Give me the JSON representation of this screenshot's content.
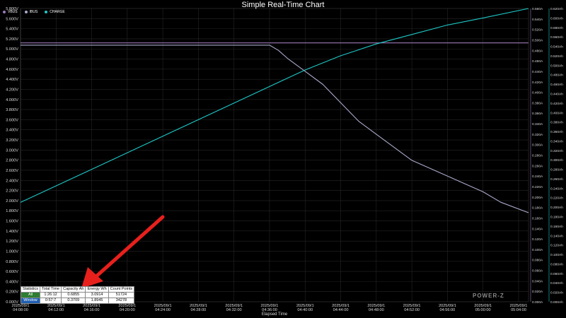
{
  "title": "Simple Real-Time Chart",
  "xlabel": "Elapsed Time",
  "watermark": "power-z",
  "colors": {
    "vbus": "#9c7ab8",
    "ibus": "#aaaacc",
    "charge": "#1ec8c8",
    "arrow": "#e8201c"
  },
  "legend": [
    {
      "name": "VBUS",
      "color": "#9c7ab8"
    },
    {
      "name": "IBUS",
      "color": "#aaaacc"
    },
    {
      "name": "CHARGE",
      "color": "#1ec8c8"
    }
  ],
  "stats": {
    "headers": [
      "Statistics",
      "Total Time",
      "Capacity Ah",
      "Energy Wh",
      "Count Points"
    ],
    "rows": [
      [
        "All",
        "1:26:12",
        "0.6855",
        "3.0914",
        "51724"
      ],
      [
        "Window",
        "0:57:7",
        "0.3709",
        "1.8945",
        "34278"
      ]
    ]
  },
  "chart_data": {
    "type": "line",
    "title": "Simple Real-Time Chart",
    "xlabel": "Elapsed Time",
    "grid": true,
    "legend_position": "top-left",
    "x_ticks": [
      [
        "2025/09/1",
        "04:08:00"
      ],
      [
        "2025/09/1",
        "04:12:00"
      ],
      [
        "2025/09/1",
        "04:16:00"
      ],
      [
        "2025/09/1",
        "04:20:00"
      ],
      [
        "2025/09/1",
        "04:24:00"
      ],
      [
        "2025/09/1",
        "04:28:00"
      ],
      [
        "2025/09/1",
        "04:32:00"
      ],
      [
        "2025/09/1",
        "04:36:00"
      ],
      [
        "2025/09/1",
        "04:40:00"
      ],
      [
        "2025/09/1",
        "04:44:00"
      ],
      [
        "2025/09/1",
        "04:48:00"
      ],
      [
        "2025/09/1",
        "04:52:00"
      ],
      [
        "2025/09/1",
        "04:56:00"
      ],
      [
        "2025/09/1",
        "05:00:00"
      ],
      [
        "2025/09/1",
        "05:04:00"
      ]
    ],
    "xlim": [
      "04:08:00",
      "05:05:07"
    ],
    "y_left": {
      "ylim": [
        0,
        5.8
      ],
      "ticks": [
        "0.000V",
        "0.200V",
        "0.400V",
        "0.600V",
        "0.800V",
        "1.000V",
        "1.200V",
        "1.400V",
        "1.600V",
        "1.800V",
        "2.000V",
        "2.200V",
        "2.400V",
        "2.600V",
        "2.800V",
        "3.000V",
        "3.200V",
        "3.400V",
        "3.600V",
        "3.800V",
        "4.000V",
        "4.200V",
        "4.400V",
        "4.600V",
        "4.800V",
        "5.000V",
        "5.200V",
        "5.400V",
        "5.600V",
        "5.800V"
      ]
    },
    "y_right_current": {
      "ylim": [
        0,
        0.56
      ],
      "ticks": [
        "0.000A",
        "0.020A",
        "0.040A",
        "0.060A",
        "0.080A",
        "0.100A",
        "0.120A",
        "0.140A",
        "0.160A",
        "0.180A",
        "0.200A",
        "0.220A",
        "0.240A",
        "0.260A",
        "0.280A",
        "0.300A",
        "0.320A",
        "0.340A",
        "0.360A",
        "0.380A",
        "0.400A",
        "0.420A",
        "0.440A",
        "0.460A",
        "0.480A",
        "0.500A",
        "0.520A",
        "0.540A",
        "0.560A"
      ]
    },
    "y_right_charge": {
      "ylim": [
        0,
        0.62
      ],
      "ticks": [
        "0.000Ah",
        "0.020Ah",
        "0.040Ah",
        "0.060Ah",
        "0.080Ah",
        "0.100Ah",
        "0.120Ah",
        "0.140Ah",
        "0.160Ah",
        "0.180Ah",
        "0.200Ah",
        "0.220Ah",
        "0.240Ah",
        "0.260Ah",
        "0.280Ah",
        "0.300Ah",
        "0.320Ah",
        "0.340Ah",
        "0.360Ah",
        "0.380Ah",
        "0.400Ah",
        "0.420Ah",
        "0.440Ah",
        "0.460Ah",
        "0.480Ah",
        "0.500Ah",
        "0.520Ah",
        "0.540Ah",
        "0.560Ah",
        "0.580Ah",
        "0.600Ah",
        "0.620Ah"
      ]
    },
    "series": [
      {
        "name": "VBUS",
        "axis": "left",
        "x": [
          "04:08:00",
          "05:05:07"
        ],
        "values": [
          5.12,
          5.12
        ]
      },
      {
        "name": "IBUS",
        "axis": "current",
        "x": [
          "04:08:00",
          "04:36:00",
          "04:37:00",
          "04:38:00",
          "04:40:00",
          "04:42:00",
          "04:44:00",
          "04:46:00",
          "04:48:00",
          "04:50:00",
          "04:52:00",
          "04:54:00",
          "04:56:00",
          "04:58:00",
          "05:00:00",
          "05:02:00",
          "05:05:07"
        ],
        "values": [
          0.49,
          0.49,
          0.48,
          0.465,
          0.44,
          0.415,
          0.38,
          0.345,
          0.32,
          0.295,
          0.27,
          0.255,
          0.24,
          0.225,
          0.21,
          0.19,
          0.17
        ]
      },
      {
        "name": "CHARGE",
        "axis": "charge",
        "x": [
          "04:08:00",
          "04:16:00",
          "04:24:00",
          "04:32:00",
          "04:36:00",
          "04:40:00",
          "04:44:00",
          "04:48:00",
          "04:52:00",
          "04:56:00",
          "05:00:00",
          "05:05:07"
        ],
        "values": [
          0.21,
          0.28,
          0.35,
          0.42,
          0.455,
          0.49,
          0.52,
          0.545,
          0.565,
          0.585,
          0.6,
          0.62
        ]
      }
    ]
  }
}
